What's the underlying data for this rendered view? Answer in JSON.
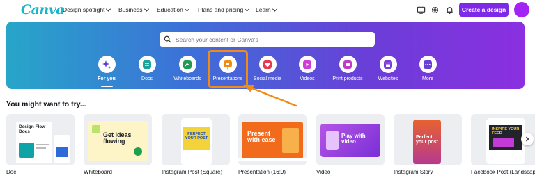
{
  "header": {
    "logo": "Canva",
    "nav": [
      {
        "label": "Design spotlight"
      },
      {
        "label": "Business"
      },
      {
        "label": "Education"
      },
      {
        "label": "Plans and pricing"
      },
      {
        "label": "Learn"
      }
    ],
    "create_button": "Create a design"
  },
  "search": {
    "placeholder": "Search your content or Canva's"
  },
  "categories": [
    {
      "label": "For you",
      "icon": "sparkle-icon",
      "color": "#5b3fd6"
    },
    {
      "label": "Docs",
      "icon": "docs-icon",
      "color": "#1aa39a"
    },
    {
      "label": "Whiteboards",
      "icon": "whiteboard-icon",
      "color": "#1c9b54"
    },
    {
      "label": "Presentations",
      "icon": "presentation-icon",
      "color": "#f08c14"
    },
    {
      "label": "Social media",
      "icon": "heart-icon",
      "color": "#e8384f"
    },
    {
      "label": "Videos",
      "icon": "video-icon",
      "color": "#cf3cd6"
    },
    {
      "label": "Print products",
      "icon": "print-icon",
      "color": "#c238c9"
    },
    {
      "label": "Websites",
      "icon": "website-icon",
      "color": "#7a3bd8"
    },
    {
      "label": "More",
      "icon": "more-icon",
      "color": "#6b3fd6"
    }
  ],
  "section": {
    "title": "You might want to try...",
    "cards": [
      {
        "label": "Doc",
        "thumb_text": "Design Flow Docs"
      },
      {
        "label": "Whiteboard",
        "thumb_text": "Get ideas flowing"
      },
      {
        "label": "Instagram Post (Square)",
        "thumb_text": "PERFECT YOUR POST"
      },
      {
        "label": "Presentation (16:9)",
        "thumb_text": "Present with ease"
      },
      {
        "label": "Video",
        "thumb_text": "Play with video"
      },
      {
        "label": "Instagram Story",
        "thumb_text": "Perfect your post"
      },
      {
        "label": "Facebook Post (Landscape)",
        "thumb_text": "INSPIRE YOUR FEED"
      }
    ]
  },
  "colors": {
    "brand_purple": "#7d2ae8",
    "highlight_orange": "#f08c14",
    "logo_teal": "#16b5c9"
  }
}
